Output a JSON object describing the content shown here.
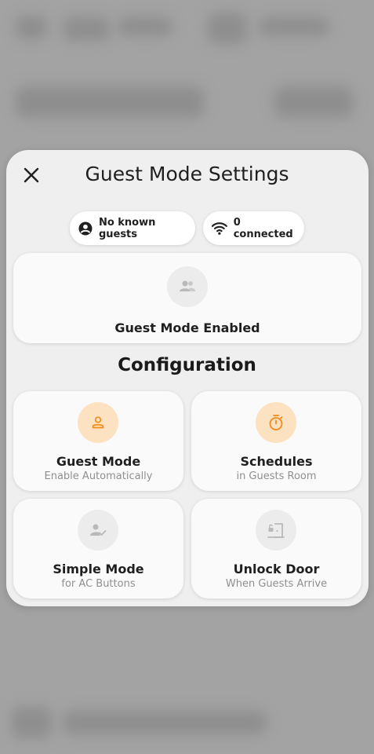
{
  "dialog": {
    "title": "Guest Mode Settings",
    "close_icon": "close-icon"
  },
  "chips": {
    "guests": {
      "label": "No known guests",
      "icon": "account-circle-icon"
    },
    "connected": {
      "label": "0 connected",
      "icon": "wifi-icon"
    }
  },
  "main_card": {
    "label": "Guest Mode Enabled",
    "icon": "people-icon"
  },
  "section_title": "Configuration",
  "tiles": [
    {
      "title": "Guest Mode",
      "subtitle": "Enable Automatically",
      "icon": "person-outline-icon",
      "accent": "#f28c1a"
    },
    {
      "title": "Schedules",
      "subtitle": "in Guests Room",
      "icon": "timer-icon",
      "accent": "#f28c1a"
    },
    {
      "title": "Simple Mode",
      "subtitle": "for AC Buttons",
      "icon": "person-check-icon",
      "accent": "#b9b9b9"
    },
    {
      "title": "Unlock Door",
      "subtitle": "When Guests Arrive",
      "icon": "door-unlock-icon",
      "accent": "#b9b9b9"
    }
  ],
  "colors": {
    "accent_orange": "#f28c1a",
    "accent_bg": "#fde2c2",
    "inactive": "#b9b9b9"
  }
}
